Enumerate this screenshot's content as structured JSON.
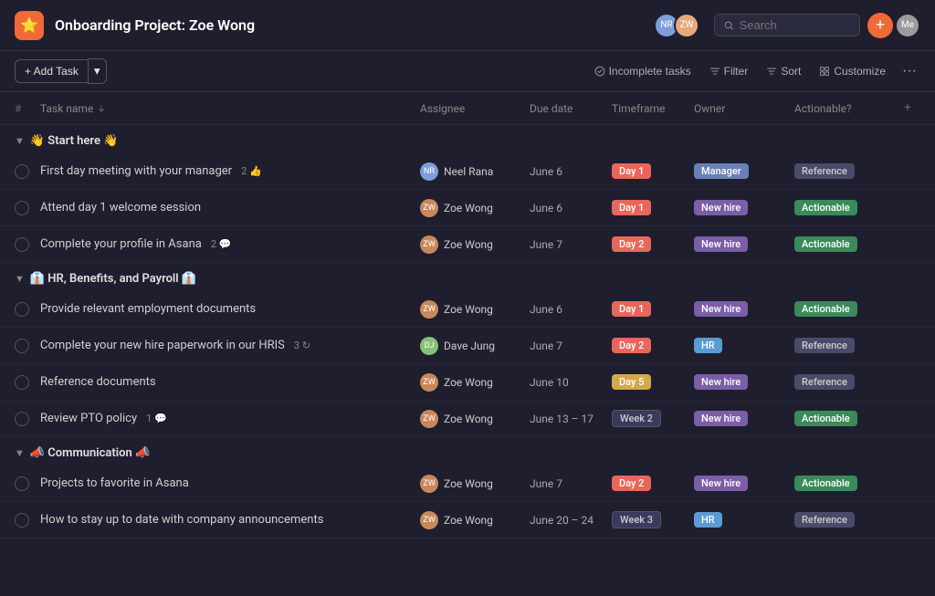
{
  "header": {
    "logo_icon": "⭐",
    "title": "Onboarding Project: Zoe Wong",
    "search_placeholder": "Search",
    "add_button_label": "+"
  },
  "toolbar": {
    "add_task_label": "+ Add Task",
    "add_task_dropdown": "▾",
    "incomplete_tasks_label": "Incomplete tasks",
    "filter_label": "Filter",
    "sort_label": "Sort",
    "customize_label": "Customize",
    "more_label": "···"
  },
  "columns": {
    "hash": "#",
    "task_name": "Task name",
    "assignee": "Assignee",
    "due_date": "Due date",
    "timeframe": "Timeframe",
    "owner": "Owner",
    "actionable": "Actionable?"
  },
  "sections": [
    {
      "id": "start-here",
      "title": "👋 Start here 👋",
      "tasks": [
        {
          "name": "First day meeting with your manager",
          "count": "2",
          "count_icon": "👍",
          "assignee_name": "Neel Rana",
          "assignee_color": "#7c9ed9",
          "assignee_initials": "NR",
          "due_date": "June 6",
          "timeframe_label": "Day 1",
          "timeframe_class": "badge-day1",
          "owner_label": "Manager",
          "owner_class": "badge-manager",
          "actionable_label": "Reference",
          "actionable_class": "badge-reference"
        },
        {
          "name": "Attend day 1 welcome session",
          "count": "",
          "assignee_name": "Zoe Wong",
          "assignee_color": "#e8a87c",
          "assignee_initials": "ZW",
          "due_date": "June 6",
          "timeframe_label": "Day 1",
          "timeframe_class": "badge-day1",
          "owner_label": "New hire",
          "owner_class": "badge-new-hire",
          "actionable_label": "Actionable",
          "actionable_class": "badge-actionable"
        },
        {
          "name": "Complete your profile in Asana",
          "count": "2",
          "count_icon": "💬",
          "assignee_name": "Zoe Wong",
          "assignee_color": "#e8a87c",
          "assignee_initials": "ZW",
          "due_date": "June 7",
          "timeframe_label": "Day 2",
          "timeframe_class": "badge-day2",
          "owner_label": "New hire",
          "owner_class": "badge-new-hire",
          "actionable_label": "Actionable",
          "actionable_class": "badge-actionable"
        }
      ]
    },
    {
      "id": "hr-benefits",
      "title": "👔 HR, Benefits, and Payroll 👔",
      "tasks": [
        {
          "name": "Provide relevant employment documents",
          "count": "",
          "assignee_name": "Zoe Wong",
          "assignee_color": "#e8a87c",
          "assignee_initials": "ZW",
          "due_date": "June 6",
          "timeframe_label": "Day 1",
          "timeframe_class": "badge-day1",
          "owner_label": "New hire",
          "owner_class": "badge-new-hire",
          "actionable_label": "Actionable",
          "actionable_class": "badge-actionable"
        },
        {
          "name": "Complete your new hire paperwork in our HRIS",
          "count": "3",
          "count_icon": "↻",
          "assignee_name": "Dave Jung",
          "assignee_color": "#88c077",
          "assignee_initials": "DJ",
          "due_date": "June 7",
          "timeframe_label": "Day 2",
          "timeframe_class": "badge-day2",
          "owner_label": "HR",
          "owner_class": "badge-hr",
          "actionable_label": "Reference",
          "actionable_class": "badge-reference"
        },
        {
          "name": "Reference documents",
          "count": "",
          "assignee_name": "Zoe Wong",
          "assignee_color": "#e8a87c",
          "assignee_initials": "ZW",
          "due_date": "June 10",
          "timeframe_label": "Day 5",
          "timeframe_class": "badge-day5",
          "owner_label": "New hire",
          "owner_class": "badge-new-hire",
          "actionable_label": "Reference",
          "actionable_class": "badge-reference"
        },
        {
          "name": "Review PTO policy",
          "count": "1",
          "count_icon": "💬",
          "assignee_name": "Zoe Wong",
          "assignee_color": "#e8a87c",
          "assignee_initials": "ZW",
          "due_date": "June 13 – 17",
          "timeframe_label": "Week 2",
          "timeframe_class": "badge-week2",
          "owner_label": "New hire",
          "owner_class": "badge-new-hire",
          "actionable_label": "Actionable",
          "actionable_class": "badge-actionable"
        }
      ]
    },
    {
      "id": "communication",
      "title": "📣 Communication 📣",
      "tasks": [
        {
          "name": "Projects to favorite in Asana",
          "count": "",
          "assignee_name": "Zoe Wong",
          "assignee_color": "#e8a87c",
          "assignee_initials": "ZW",
          "due_date": "June 7",
          "timeframe_label": "Day 2",
          "timeframe_class": "badge-day2",
          "owner_label": "New hire",
          "owner_class": "badge-new-hire",
          "actionable_label": "Actionable",
          "actionable_class": "badge-actionable"
        },
        {
          "name": "How to stay up to date with company announcements",
          "count": "",
          "assignee_name": "Zoe Wong",
          "assignee_color": "#e8a87c",
          "assignee_initials": "ZW",
          "due_date": "June 20 – 24",
          "timeframe_label": "Week 3",
          "timeframe_class": "badge-week3",
          "owner_label": "HR",
          "owner_class": "badge-hr",
          "actionable_label": "Reference",
          "actionable_class": "badge-reference"
        }
      ]
    }
  ]
}
